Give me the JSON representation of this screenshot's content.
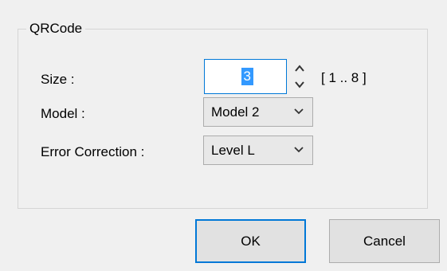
{
  "group": {
    "legend": "QRCode"
  },
  "size": {
    "label": "Size :",
    "value": "3",
    "range": "[ 1 .. 8 ]"
  },
  "model": {
    "label": "Model :",
    "selected": "Model 2"
  },
  "error_correction": {
    "label": "Error Correction :",
    "selected": "Level L"
  },
  "buttons": {
    "ok": "OK",
    "cancel": "Cancel"
  },
  "icons": {
    "spin_up": "chevron-up-icon",
    "spin_down": "chevron-down-icon",
    "dropdown": "chevron-down-icon"
  },
  "colors": {
    "dialog_bg": "#f0f0f0",
    "focus_border": "#0078d7",
    "selection_bg": "#3399ff",
    "button_bg": "#e1e1e1",
    "select_bg": "#e8e8e8"
  }
}
